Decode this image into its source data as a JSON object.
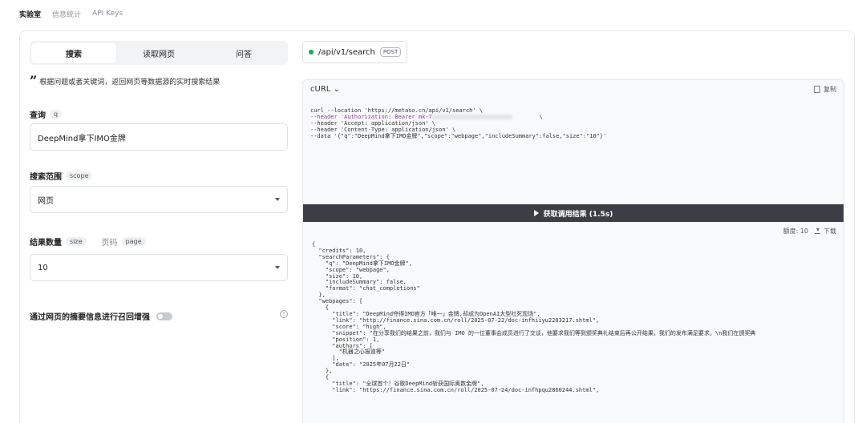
{
  "topnav": {
    "items": [
      {
        "label": "实验室",
        "active": true
      },
      {
        "label": "信息统计",
        "active": false
      },
      {
        "label": "API Keys",
        "active": false
      }
    ]
  },
  "tabs": [
    {
      "label": "搜索",
      "active": true
    },
    {
      "label": "读取网页",
      "active": false
    },
    {
      "label": "问答",
      "active": false
    }
  ],
  "description": "根据问题或者关键词，返回网页等数据源的实时搜索结果",
  "query": {
    "label": "查询",
    "param": "q",
    "value": "DeepMind拿下IMO金牌"
  },
  "scope": {
    "label": "搜索范围",
    "param": "scope",
    "value": "网页"
  },
  "size": {
    "label": "结果数量",
    "param": "size",
    "value": "10"
  },
  "page": {
    "label": "页码",
    "param": "page"
  },
  "summary_toggle": {
    "label": "通过网页的摘要信息进行召回增强",
    "enabled": false
  },
  "endpoint": {
    "path": "/api/v1/search",
    "method": "POST",
    "status_color": "#1aa55a"
  },
  "code": {
    "language": "cURL",
    "copy_label": "复制",
    "lines": {
      "l1": "curl --location 'https://metaso.cn/api/v1/search' \\",
      "l2a": "--header 'Authorization: Bearer mk-7",
      "l2b": "\\",
      "l3": "--header 'Accept: application/json' \\",
      "l4": "--header 'Content-Type: application/json' \\",
      "l5": "--data '{\"q\":\"DeepMind拿下IMO金牌\",\"scope\":\"webpage\",\"includeSummary\":false,\"size\":\"10\"}'"
    }
  },
  "run_button": {
    "label": "获取调用结果 (1.5s)"
  },
  "result": {
    "quota_label": "额度: 10",
    "download_label": "下载",
    "text": "{\n  \"credits\": 10,\n  \"searchParameters\": {\n    \"q\": \"DeepMind拿下IMO金牌\",\n    \"scope\": \"webpage\",\n    \"size\": 10,\n    \"includeSummary\": false,\n    \"format\": \"chat_completions\"\n  },\n  \"webpages\": [\n    {\n      \"title\": \"DeepMind夺得IMO官方「唯一」金牌,却成为OpenAI大型社死现场\",\n      \"link\": \"http://finance.sina.com.cn/roll/2025-07-22/doc-infhiiyu2283217.shtml\",\n      \"score\": \"high\",\n      \"snippet\": \"在分享我们的结果之前，我们与 IMO 的一位董事会成员进行了交谈，他要求我们等到颁奖典礼结束后再公开结果，我们的发布满足要求。\\n我们在颁奖典\n      \"position\": 1,\n      \"authors\": [\n        \"机器之心报道等\"\n      ],\n      \"date\": \"2025年07月22日\"\n    },\n    {\n      \"title\": \"全球首个！谷歌DeepMind斩获国际奥数金牌\",\n      \"link\": \"https://finance.sina.com.cn/roll/2025-07-24/doc-infhpqu2860244.shtml\","
  }
}
